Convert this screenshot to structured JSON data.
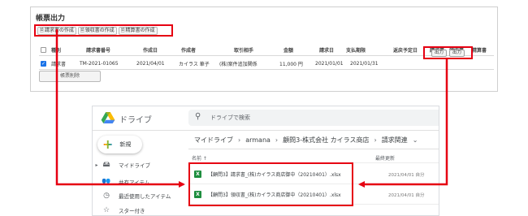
{
  "top": {
    "title": "帳票出力",
    "buttons": [
      {
        "label": "請求書の作成"
      },
      {
        "label": "領収書の作成"
      },
      {
        "label": "精算書の作成"
      }
    ],
    "columns": [
      "",
      "種別",
      "請求書番号",
      "作成日",
      "作成者",
      "取引相手",
      "金額",
      "請求日",
      "支払期限",
      "返戻予定日",
      "請求書",
      "領収書",
      "精算書"
    ],
    "row": {
      "type": "請求書",
      "number": "TM-2021-01065",
      "created": "2021/04/01",
      "creator": "カイラス 華子",
      "partner": "(株)案件追加関係",
      "amount": "11,000 円",
      "invoice_date": "2021/01/01",
      "due": "2021/01/31",
      "output_invoice": "出力",
      "output_receipt": "出力"
    },
    "delete_label": "帳票削除"
  },
  "drive": {
    "app_name": "ドライブ",
    "search_placeholder": "ドライブで検索",
    "new_label": "新規",
    "sidebar": [
      {
        "label": "マイドライブ",
        "icon": "my-drive-icon"
      },
      {
        "label": "共有アイテム",
        "icon": "shared-icon"
      },
      {
        "label": "最近使用したアイテム",
        "icon": "clock-icon"
      },
      {
        "label": "スター付き",
        "icon": "star-icon"
      }
    ],
    "breadcrumb": [
      "マイドライブ",
      "armana",
      "顧問3-株式会社 カイラス商店",
      "請求関連"
    ],
    "col_name": "名前 ↑",
    "col_modified": "最終更新",
    "files": [
      {
        "name": "【顧問3】請求書_(株)カイラス商店御中（20210401）.xlsx",
        "modified": "2021/04/01 自分"
      },
      {
        "name": "【顧問3】領収書_(株)カイラス商店御中（20210401）.xlsx",
        "modified": "2021/04/01 自分"
      }
    ]
  },
  "colors": {
    "highlight": "#e60012",
    "excel": "#1e8e3e"
  }
}
